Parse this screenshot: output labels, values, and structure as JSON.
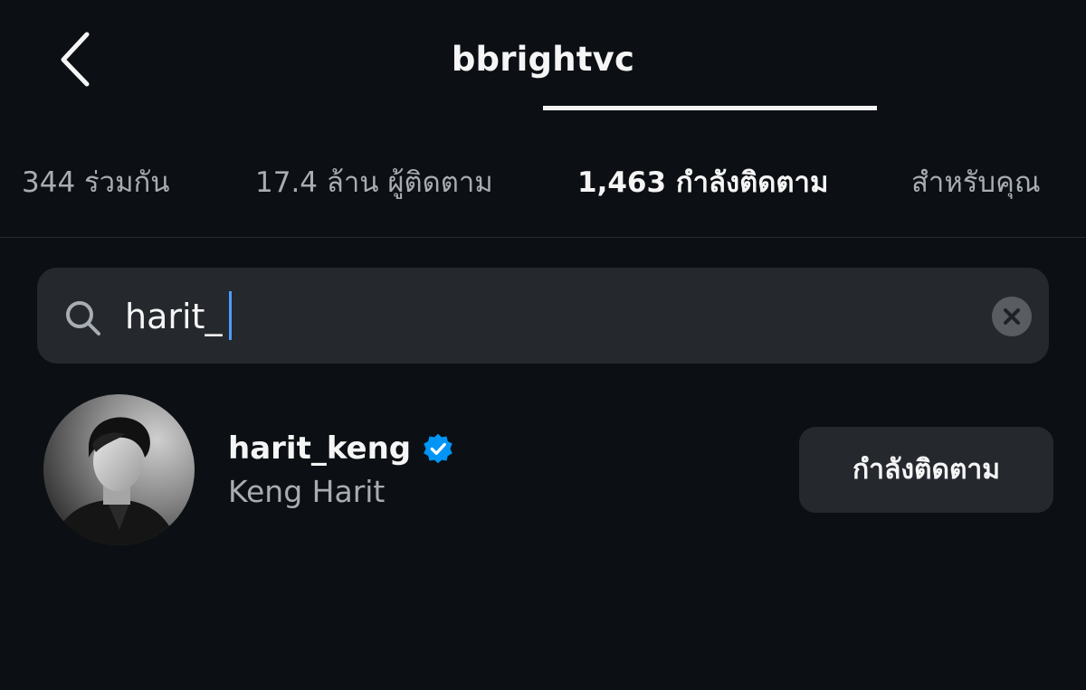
{
  "header": {
    "title": "bbrightvc",
    "back_icon": "chevron-left-icon"
  },
  "tabs": [
    {
      "label": "344 ร่วมกัน",
      "active": false
    },
    {
      "label": "17.4 ล้าน ผู้ติดตาม",
      "active": false
    },
    {
      "label": "1,463 กำลังติดตาม",
      "active": true
    },
    {
      "label": "สำหรับคุณ",
      "active": false
    }
  ],
  "search": {
    "value": "harit_",
    "icon": "search-icon",
    "clear_icon": "close-icon"
  },
  "results": [
    {
      "username": "harit_keng",
      "verified": true,
      "full_name": "Keng Harit",
      "button_label": "กำลังติดตาม"
    }
  ],
  "colors": {
    "background": "#0c1014",
    "surface": "#25292e",
    "text_primary": "#f5f5f5",
    "text_secondary": "#a8adb3",
    "verified_blue": "#0095f6",
    "caret": "#4a9eff"
  }
}
